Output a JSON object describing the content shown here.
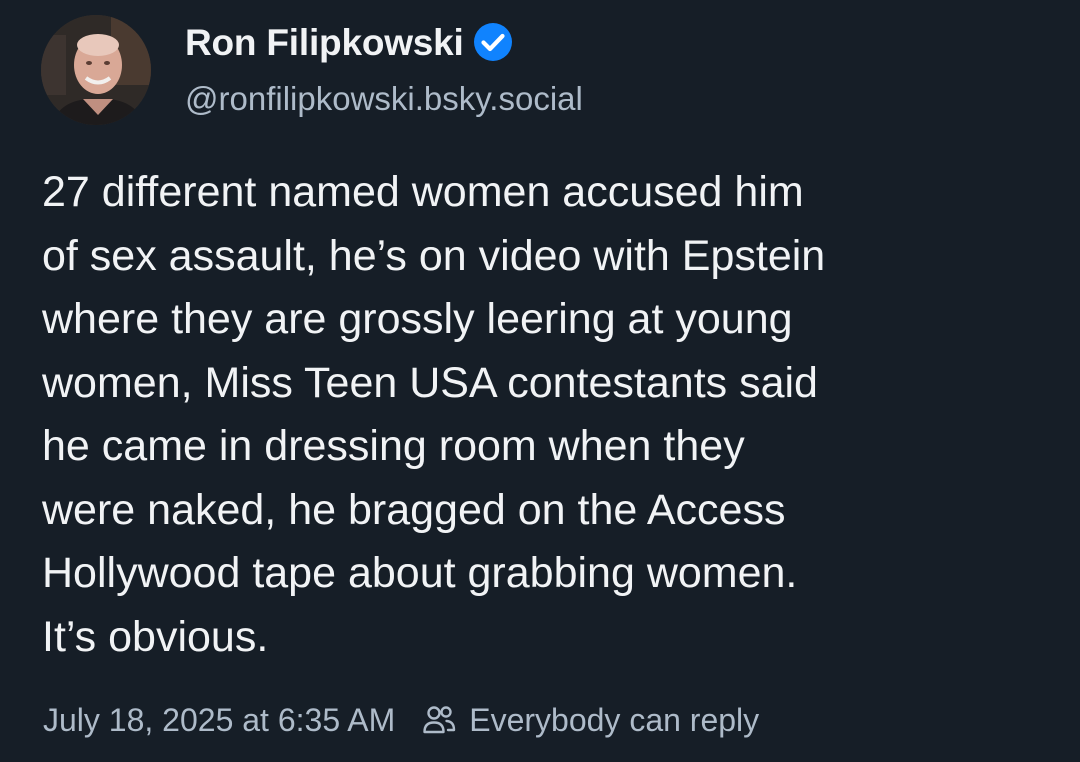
{
  "author": {
    "display_name": "Ron Filipkowski",
    "handle": "@ronfilipkowski.bsky.social",
    "verified_icon": "verified-checkmark-icon",
    "avatar": "profile-photo"
  },
  "post": {
    "text_lines": [
      "27 different named women accused him",
      "of sex assault, he’s on video with Epstein",
      "where they are grossly leering at young",
      "women, Miss Teen USA contestants said",
      "he came in dressing room when they",
      "were naked, he bragged on the Access",
      "Hollywood tape about grabbing women.",
      "It’s obvious."
    ],
    "timestamp": "July 18, 2025 at 6:35 AM",
    "reply_setting_icon": "people-icon",
    "reply_setting": "Everybody can reply"
  },
  "colors": {
    "background": "#161e27",
    "text": "#f1f3f5",
    "secondary_text": "#aebbc9",
    "verified_badge": "#1083fe"
  }
}
